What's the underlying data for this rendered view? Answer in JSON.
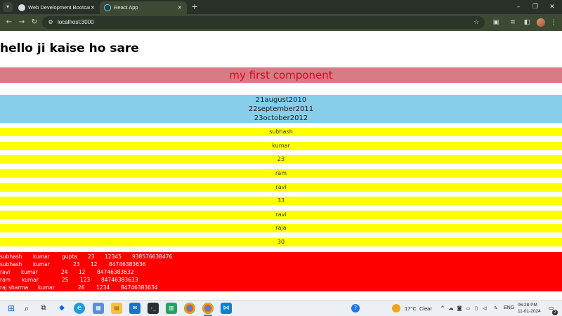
{
  "browser": {
    "tabs": [
      {
        "title": "Web Development Bootcamp [",
        "active": false
      },
      {
        "title": "React App",
        "active": true
      }
    ],
    "address": {
      "url": "localhost:3000"
    },
    "icons": {
      "tab_menu": "chevron-down-icon",
      "close": "×",
      "new_tab": "+",
      "back": "←",
      "forward": "→",
      "reload": "↻",
      "site_info": "⚙",
      "star": "☆",
      "minimize": "–",
      "restore": "❐",
      "window_close": "✕"
    }
  },
  "page": {
    "heading": "hello ji kaise ho sare",
    "component_title": "my first component",
    "dates": [
      "21august2010",
      "22september2011",
      "23october2012"
    ],
    "yellow_items": [
      "subhash",
      "kumar",
      "23",
      "ram",
      "ravi",
      "33",
      "ravi",
      "raja",
      "30"
    ],
    "red_rows": [
      [
        "subhash",
        "kumar",
        "gupta",
        "23",
        "12345",
        "938576638476"
      ],
      [
        "subhash",
        "kumar",
        "",
        "23",
        "12",
        "84746383636"
      ],
      [
        "ravi",
        "kumar",
        "",
        "24",
        "12",
        "84746383632"
      ],
      [
        "ram",
        "kumar",
        "",
        "25",
        "123",
        "84746383633"
      ],
      [
        "raj sharma",
        "kumar",
        "",
        "26",
        "1234",
        "84746383634"
      ]
    ],
    "colors": {
      "component_bg": "#d77b86",
      "component_text": "#e8001a",
      "dates_bg": "#87ceeb",
      "yellow": "#ffff00",
      "red": "#ff0000"
    }
  },
  "taskbar": {
    "weather_temp": "17°C",
    "weather_text": "Clear",
    "language": "ENG",
    "time": "06:28 PM",
    "date": "11-01-2024",
    "notification_count": "2",
    "icons": [
      "windows-start-icon",
      "search-icon",
      "task-view-icon",
      "dropbox-icon",
      "edge-icon",
      "photos-icon",
      "file-explorer-icon",
      "mail-icon",
      "terminal-icon",
      "sheets-icon",
      "chrome-icon",
      "chrome-icon",
      "vscode-icon"
    ]
  }
}
